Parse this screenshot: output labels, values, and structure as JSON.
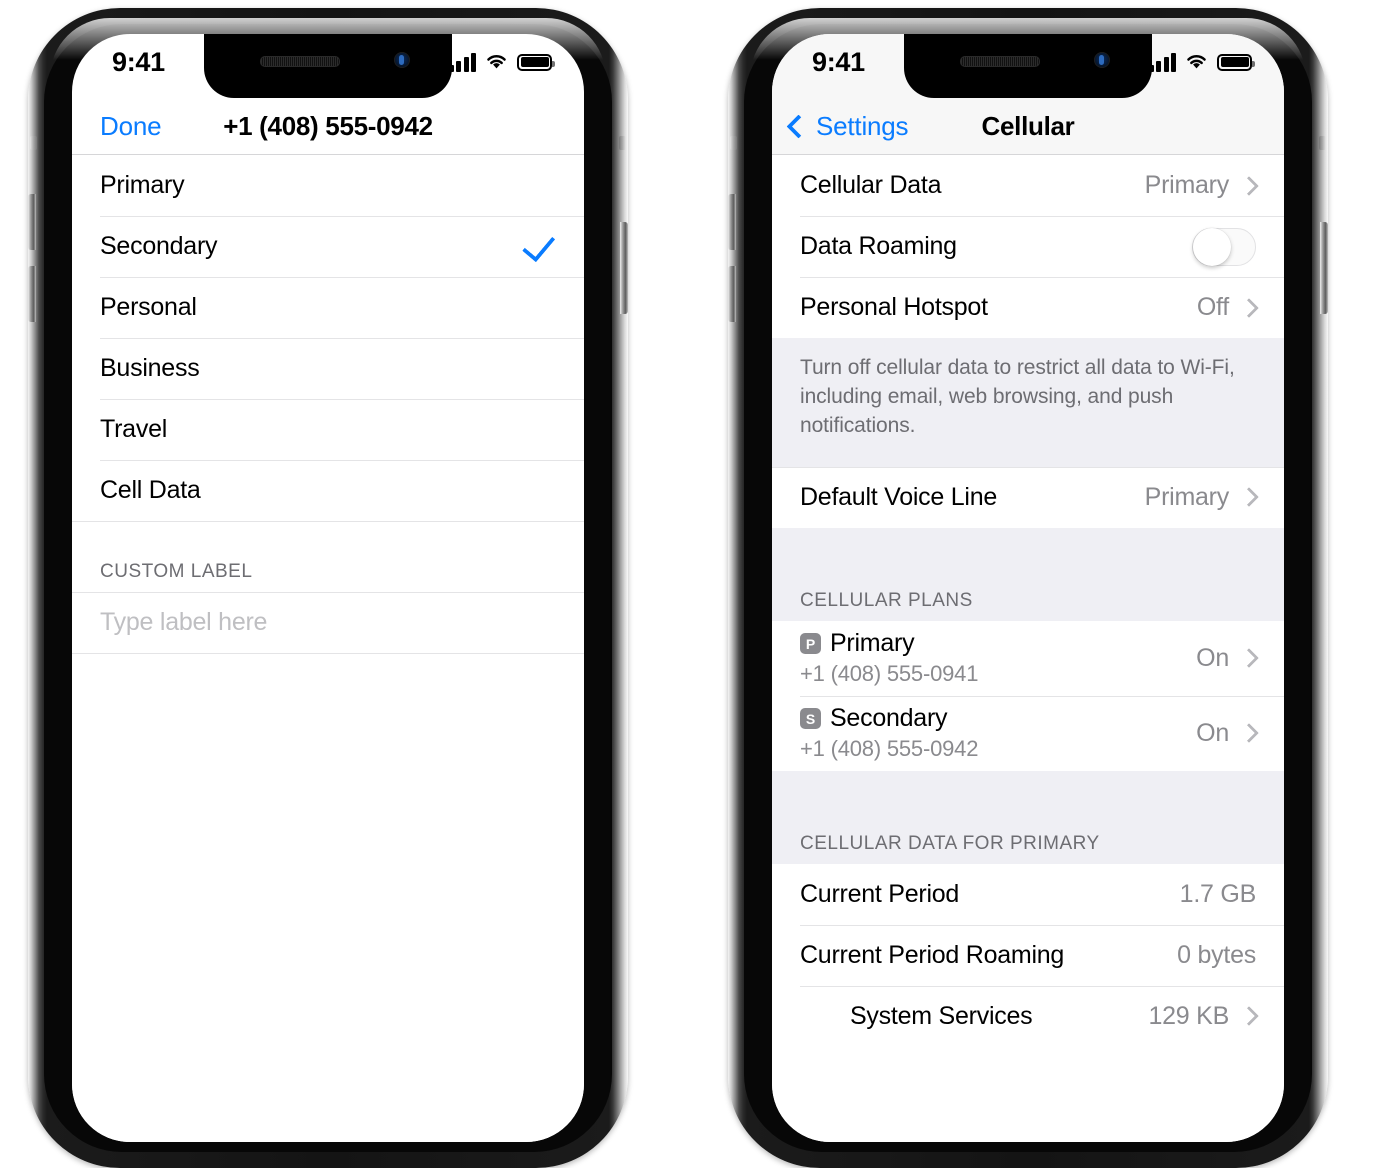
{
  "status_bar": {
    "time": "9:41",
    "signal_icon": "cellular-signal-icon",
    "wifi_icon": "wifi-icon",
    "battery_icon": "battery-icon"
  },
  "left_phone": {
    "nav": {
      "action_label": "Done",
      "title": "+1 (408) 555-0942"
    },
    "label_options": [
      {
        "label": "Primary",
        "selected": false
      },
      {
        "label": "Secondary",
        "selected": true
      },
      {
        "label": "Personal",
        "selected": false
      },
      {
        "label": "Business",
        "selected": false
      },
      {
        "label": "Travel",
        "selected": false
      },
      {
        "label": "Cell Data",
        "selected": false
      }
    ],
    "custom_section": {
      "header": "CUSTOM LABEL",
      "input_value": "",
      "input_placeholder": "Type label here"
    }
  },
  "right_phone": {
    "nav": {
      "back_label": "Settings",
      "title": "Cellular"
    },
    "group_1": [
      {
        "label": "Cellular Data",
        "value": "Primary",
        "accessory": "chevron"
      },
      {
        "label": "Data Roaming",
        "value": "",
        "accessory": "toggle",
        "toggle_on": false
      },
      {
        "label": "Personal Hotspot",
        "value": "Off",
        "accessory": "chevron"
      }
    ],
    "footnote_1": "Turn off cellular data to restrict all data to Wi-Fi, including email, web browsing, and push notifications.",
    "group_2": [
      {
        "label": "Default Voice Line",
        "value": "Primary",
        "accessory": "chevron"
      }
    ],
    "plans_header": "CELLULAR PLANS",
    "plans": [
      {
        "badge": "P",
        "name": "Primary",
        "number": "+1 (408) 555-0941",
        "value": "On"
      },
      {
        "badge": "S",
        "name": "Secondary",
        "number": "+1 (408) 555-0942",
        "value": "On"
      }
    ],
    "usage_header": "CELLULAR DATA FOR PRIMARY",
    "usage_rows": [
      {
        "label": "Current Period",
        "value": "1.7 GB",
        "accessory": "none",
        "indent": false
      },
      {
        "label": "Current Period Roaming",
        "value": "0 bytes",
        "accessory": "none",
        "indent": false
      },
      {
        "label": "System Services",
        "value": "129 KB",
        "accessory": "chevron",
        "indent": true
      }
    ]
  },
  "colors": {
    "accent_blue": "#0A7CFF",
    "secondary_text": "#8A8A8E",
    "group_background": "#EFEFF4",
    "separator": "#E4E4E6",
    "badge_gray": "#8A8A8E"
  }
}
